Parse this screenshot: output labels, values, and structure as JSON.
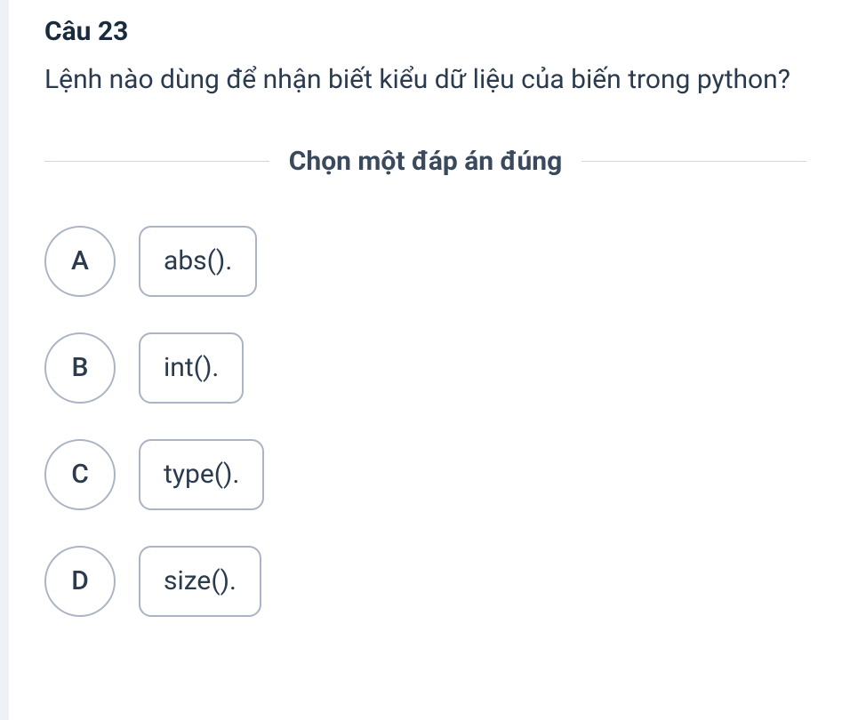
{
  "question": {
    "number": "Câu 23",
    "text": "Lệnh nào dùng để nhận biết kiểu dữ liệu của biến trong python?"
  },
  "instruction": "Chọn một đáp án đúng",
  "options": [
    {
      "letter": "A",
      "label": "abs()."
    },
    {
      "letter": "B",
      "label": "int()."
    },
    {
      "letter": "C",
      "label": "type()."
    },
    {
      "letter": "D",
      "label": "size()."
    }
  ]
}
